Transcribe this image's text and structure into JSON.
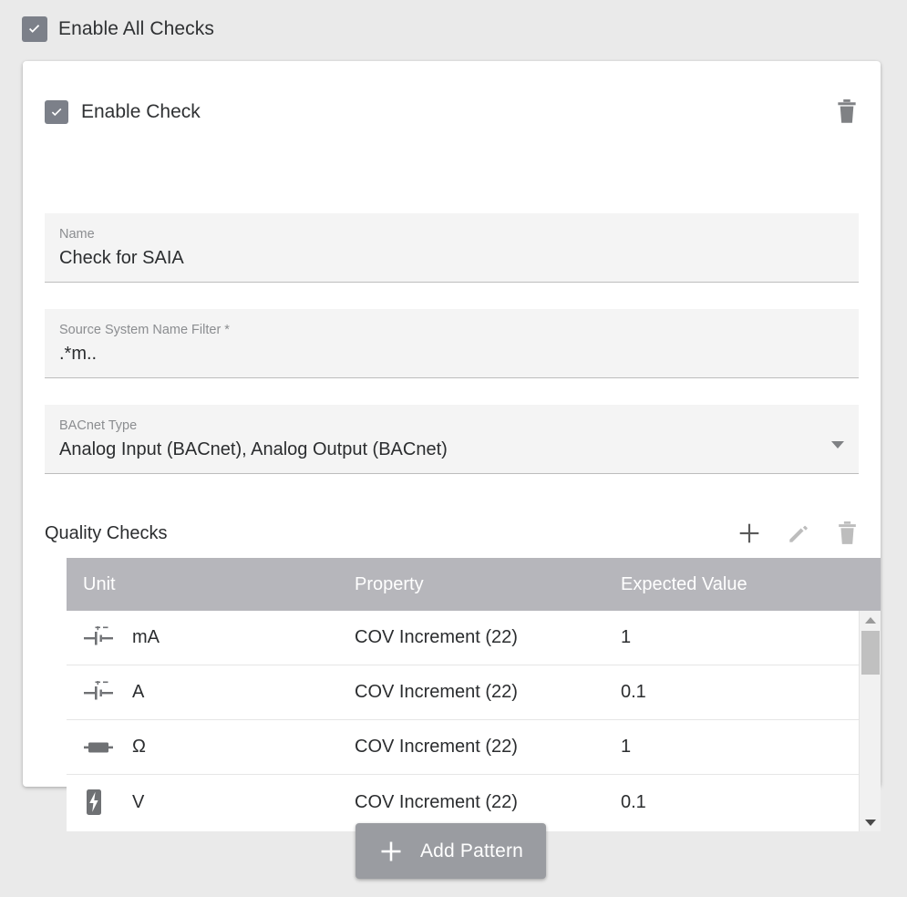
{
  "global": {
    "enable_all_label": "Enable All Checks",
    "enable_all_checked": "true",
    "background_color": "#eaeaea",
    "accent_color": "#7c8089"
  },
  "card": {
    "enable_check_label": "Enable Check",
    "enable_check_checked": "true",
    "delete_icon": "trash-icon",
    "fields": {
      "name": {
        "label": "Name",
        "value": "Check for SAIA",
        "placeholder": "Name"
      },
      "source_filter": {
        "label": "Source System Name Filter *",
        "value": ".*m..",
        "placeholder": "Source System Name Filter"
      },
      "bacnet_type": {
        "label": "BACnet Type",
        "value": "Analog Input (BACnet), Analog Output (BACnet)",
        "arrow_icon": "chevron-down-icon"
      }
    },
    "quality_checks": {
      "title": "Quality Checks",
      "actions": [
        {
          "name": "add-quality-check-button",
          "icon": "plus-icon",
          "color": "#5a5a5a"
        },
        {
          "name": "edit-quality-check-button",
          "icon": "pencil-icon",
          "color": "#bdbdbd"
        },
        {
          "name": "delete-quality-check-button",
          "icon": "trash-icon",
          "color": "#bdbdbd"
        }
      ],
      "columns": [
        "Unit",
        "Property",
        "Expected Value"
      ],
      "header_bg": "#b6b6bb",
      "rows": [
        {
          "unit_icon": "battery-cell-icon",
          "unit": "mA",
          "property": "COV Increment (22)",
          "expected_value": "1"
        },
        {
          "unit_icon": "battery-cell-icon",
          "unit": "A",
          "property": "COV Increment (22)",
          "expected_value": "0.1"
        },
        {
          "unit_icon": "resistor-icon",
          "unit": "Ω",
          "property": "COV Increment (22)",
          "expected_value": "1"
        },
        {
          "unit_icon": "battery-bolt-icon",
          "unit": "V",
          "property": "COV Increment (22)",
          "expected_value": "0.1"
        }
      ],
      "scrollbar": {
        "up_icon": "scroll-up-arrow-icon",
        "down_icon": "scroll-down-arrow-icon",
        "thumb": "scrollbar-thumb"
      }
    }
  },
  "footer": {
    "add_pattern_label": "Add Pattern",
    "add_pattern_icon": "plus-icon",
    "add_pattern_bg": "#9a9ca1"
  }
}
